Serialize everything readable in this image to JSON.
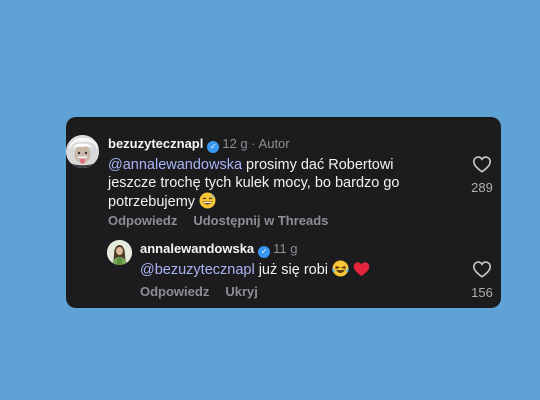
{
  "comment": {
    "username": "bezuzytecznapl",
    "time": "12 g",
    "separator": "·",
    "role": "Autor",
    "mention": "@annalewandowska",
    "text_line1": " prosimy dać Robertowi",
    "text_line2": "jeszcze trochę tych kulek mocy, bo bardzo go",
    "text_line3": "potrzebujemy",
    "emoji": "grinning-sweat",
    "likes": "289",
    "reply_label": "Odpowiedz",
    "share_label": "Udostępnij w Threads"
  },
  "reply": {
    "username": "annalewandowska",
    "time": "11 g",
    "mention": "@bezuzytecznapl",
    "text": " już się robi ",
    "emojis": [
      "laughing-tears",
      "red-heart"
    ],
    "likes": "156",
    "reply_label": "Odpowiedz",
    "hide_label": "Ukryj"
  },
  "colors": {
    "background": "#5fa3d6",
    "card": "#1c1c1e",
    "mention": "#a9b4f5",
    "verified": "#3897f0"
  }
}
